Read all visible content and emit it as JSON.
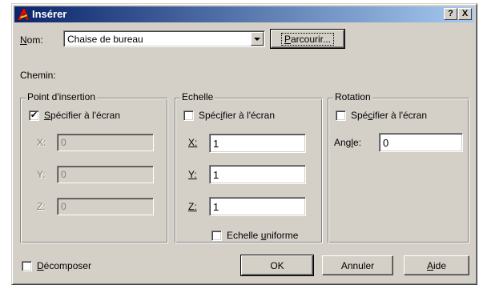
{
  "window": {
    "title": "Insérer",
    "help_button": "?",
    "close_button": "X"
  },
  "name_row": {
    "label_underlined": "N",
    "label_rest": "om:",
    "value": "Chaise de bureau",
    "browse_underlined": "P",
    "browse_rest": "arcourir..."
  },
  "path_label": "Chemin:",
  "insertion_point": {
    "title": "Point d'insertion",
    "specify_checked": true,
    "specify_underlined": "S",
    "specify_rest": "pécifier à l'écran",
    "x_label": "X:",
    "y_label": "Y:",
    "z_label": "Z:",
    "x_value": "0",
    "y_value": "0",
    "z_value": "0"
  },
  "scale": {
    "title": "Echelle",
    "specify_checked": false,
    "specify_pre": "Spéc",
    "specify_underlined": "i",
    "specify_post": "fier à l'écran",
    "x_label": "X:",
    "y_label": "Y:",
    "z_label": "Z:",
    "x_value": "1",
    "y_value": "1",
    "z_value": "1",
    "uniform_checked": false,
    "uniform_pre": "Echelle ",
    "uniform_underlined": "u",
    "uniform_post": "niforme"
  },
  "rotation": {
    "title": "Rotation",
    "specify_checked": false,
    "specify_pre": "Spé",
    "specify_underlined": "c",
    "specify_post": "ifier à l'écran",
    "angle_pre": "Ang",
    "angle_underlined": "l",
    "angle_post": "e:",
    "angle_value": "0"
  },
  "explode": {
    "checked": false,
    "underlined": "D",
    "rest": "écomposer"
  },
  "buttons": {
    "ok": "OK",
    "cancel": "Annuler",
    "help_underlined": "A",
    "help_rest": "ide"
  }
}
